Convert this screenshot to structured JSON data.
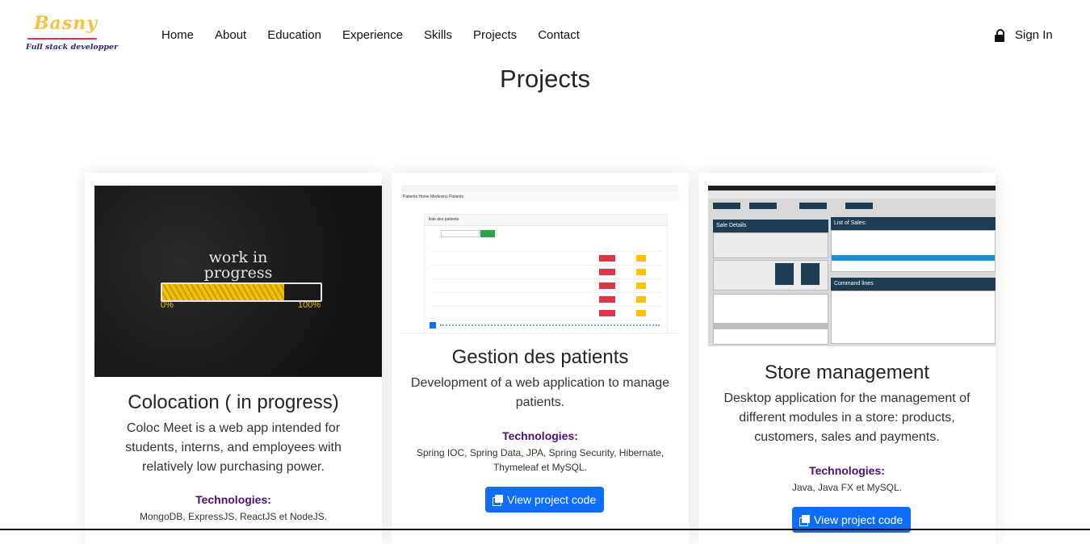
{
  "brand": {
    "name": "Basny",
    "tagline": "Full stack developper"
  },
  "nav": {
    "items": [
      "Home",
      "About",
      "Education",
      "Experience",
      "Skills",
      "Projects",
      "Contact"
    ]
  },
  "auth": {
    "signin_label": "Sign In",
    "icon": "lock-icon"
  },
  "page": {
    "title": "Projects"
  },
  "projects": [
    {
      "image": {
        "line1": "work in",
        "line2": "progress",
        "start": "0%",
        "end": "100%",
        "progress": 0.77
      },
      "title": "Colocation ( in progress)",
      "description": "Coloc Meet is a web app intended for students, interns, and employees with relatively low purchasing power.",
      "tech_heading": "Technologies:",
      "technologies": "MongoDB, ExpressJS, ReactJS et NodeJS."
    },
    {
      "image": {
        "nav_text": "Patients   Home   Medecins   Patients",
        "panel_title": "liste des patients"
      },
      "title": "Gestion des patients",
      "description": "Development of a web application to manage patients.",
      "tech_heading": "Technologies:",
      "technologies": "Spring IOC, Spring Data, JPA, Spring Security, Hibernate, Thymeleaf et MySQL.",
      "button": "View project code"
    },
    {
      "image": {
        "sale_details": "Sale Details",
        "list_sales": "List of Sales:",
        "command_lines": "Command lines"
      },
      "title": "Store management",
      "description": "Desktop application for the management of different modules in a store: products, customers, sales and payments.",
      "tech_heading": "Technologies:",
      "technologies": "Java, Java FX et MySQL.",
      "button": "View project code"
    }
  ],
  "colors": {
    "primary": "#0d6efd",
    "tech_heading": "#4b0f73",
    "logo_yellow": "#f3c23f",
    "logo_red": "#d9364b"
  }
}
